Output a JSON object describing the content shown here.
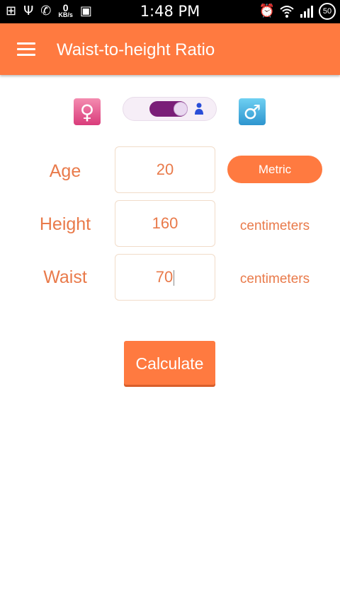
{
  "status_bar": {
    "time": "1:48 PM",
    "network_speed_value": "0",
    "network_speed_unit": "KB/s",
    "battery": "50",
    "left_icons": [
      "add-icon",
      "usb-icon",
      "whatsapp-icon",
      "network-speed-indicator",
      "image-icon"
    ],
    "right_icons": [
      "alarm-icon",
      "wifi-icon",
      "signal-icon",
      "battery-icon"
    ]
  },
  "app_bar": {
    "title": "Waist-to-height Ratio",
    "menu_icon": "hamburger-menu-icon",
    "color": "#ff7a40"
  },
  "gender": {
    "female_symbol": "♀",
    "male_symbol": "♂",
    "toggle_selected": "female",
    "toggle_icon": "person-icon"
  },
  "form": {
    "age": {
      "label": "Age",
      "value": "20"
    },
    "height": {
      "label": "Height",
      "value": "160",
      "unit": "centimeters"
    },
    "waist": {
      "label": "Waist",
      "value": "70",
      "unit": "centimeters"
    }
  },
  "unit_system_button": "Metric",
  "calculate_button": "Calculate",
  "colors": {
    "accent": "#ff7a40",
    "text_accent": "#e97a4a",
    "toggle_on": "#7a1e78",
    "female_icon": "#d93c7b",
    "male_icon": "#2d95cf"
  }
}
